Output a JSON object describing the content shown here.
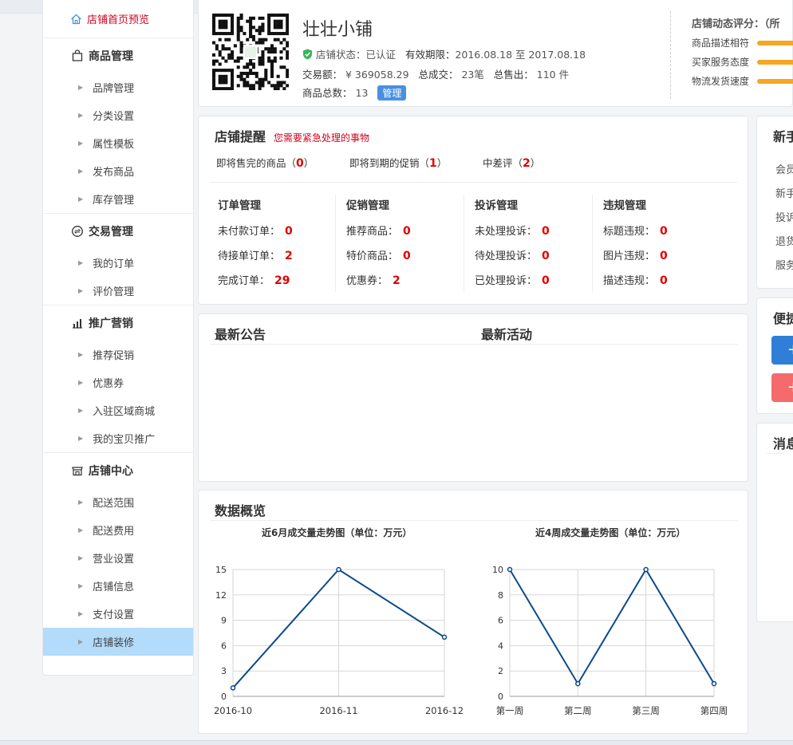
{
  "sidebar": {
    "home_label": "店铺首页预览",
    "groups": [
      {
        "title": "商品管理",
        "items": [
          "品牌管理",
          "分类设置",
          "属性模板",
          "发布商品",
          "库存管理"
        ]
      },
      {
        "title": "交易管理",
        "items": [
          "我的订单",
          "评价管理"
        ]
      },
      {
        "title": "推广营销",
        "items": [
          "推荐促销",
          "优惠券",
          "入驻区域商城",
          "我的宝贝推广"
        ]
      },
      {
        "title": "店铺中心",
        "items": [
          "配送范围",
          "配送费用",
          "营业设置",
          "店铺信息",
          "支付设置",
          "店铺装修"
        ]
      }
    ],
    "active_item": "店铺装修"
  },
  "store": {
    "name": "壮壮小铺",
    "status_label": "店铺状态：",
    "status_value": "已认证",
    "validity_label": "有效期限：",
    "validity_value": "2016.08.18 至 2017.08.18",
    "sales_label": "交易额：",
    "sales_value": "¥ 369058.29",
    "deals_label": "总成交：",
    "deals_value": "23笔",
    "sold_label": "总售出：",
    "sold_value": "110 件",
    "goods_label": "商品总数：",
    "goods_value": "13",
    "manage_label": "管理"
  },
  "rating": {
    "title": "店铺动态评分：（所",
    "items": [
      "商品描述相符",
      "买家服务态度",
      "物流发货速度"
    ]
  },
  "remind": {
    "title": "店铺提醒",
    "subtitle": "您需要紧急处理的事物",
    "items": [
      {
        "label": "即将售完的商品（",
        "value": "0",
        "end": "）"
      },
      {
        "label": "即将到期的促销（",
        "value": "1",
        "end": "）"
      },
      {
        "label": "中差评（",
        "value": "2",
        "end": "）"
      }
    ],
    "columns": [
      {
        "title": "订单管理",
        "rows": [
          {
            "label": "未付款订单：",
            "value": "0"
          },
          {
            "label": "待接单订单：",
            "value": "2"
          },
          {
            "label": "完成订单：",
            "value": "29"
          }
        ]
      },
      {
        "title": "促销管理",
        "rows": [
          {
            "label": "推荐商品：",
            "value": "0"
          },
          {
            "label": "特价商品：",
            "value": "0"
          },
          {
            "label": "优惠券：",
            "value": "2"
          }
        ]
      },
      {
        "title": "投诉管理",
        "rows": [
          {
            "label": "未处理投诉：",
            "value": "0"
          },
          {
            "label": "待处理投诉：",
            "value": "0"
          },
          {
            "label": "已处理投诉：",
            "value": "0"
          }
        ]
      },
      {
        "title": "违规管理",
        "rows": [
          {
            "label": "标题违规：",
            "value": "0"
          },
          {
            "label": "图片违规：",
            "value": "0"
          },
          {
            "label": "描述违规：",
            "value": "0"
          }
        ]
      }
    ]
  },
  "notice": {
    "title_left": "最新公告",
    "title_right": "最新活动"
  },
  "data_overview": {
    "title": "数据概览"
  },
  "chart_data": [
    {
      "type": "line",
      "title": "近6月成交量走势图（单位：万元）",
      "categories": [
        "2016-10",
        "2016-11",
        "2016-12"
      ],
      "values": [
        1,
        15,
        7
      ],
      "yticks": [
        0,
        3,
        6,
        9,
        12,
        15
      ],
      "ylim": [
        0,
        15
      ],
      "grid": true,
      "color": "#0b4a8b"
    },
    {
      "type": "line",
      "title": "近4周成交量走势图（单位：万元）",
      "categories": [
        "第一周",
        "第二周",
        "第三周",
        "第四周"
      ],
      "values": [
        10,
        1,
        10,
        1
      ],
      "yticks": [
        0,
        2,
        4,
        6,
        8,
        10
      ],
      "ylim": [
        0,
        10
      ],
      "grid": true,
      "color": "#0b4a8b"
    }
  ],
  "right": {
    "guide_title": "新手",
    "guide_items": [
      "会员",
      "新手",
      "投诉",
      "退货",
      "服务"
    ],
    "quick_title": "便捷",
    "quick_buttons": [
      {
        "label": "+",
        "color": "#2f7fd8"
      },
      {
        "label": "+",
        "color": "#f56b6b"
      }
    ],
    "message_title": "消息"
  },
  "colors": {
    "accent": "#4a90e2",
    "alert": "#e20000",
    "active_bg": "#b3dcfa",
    "rating_bar": "#f5a623"
  }
}
